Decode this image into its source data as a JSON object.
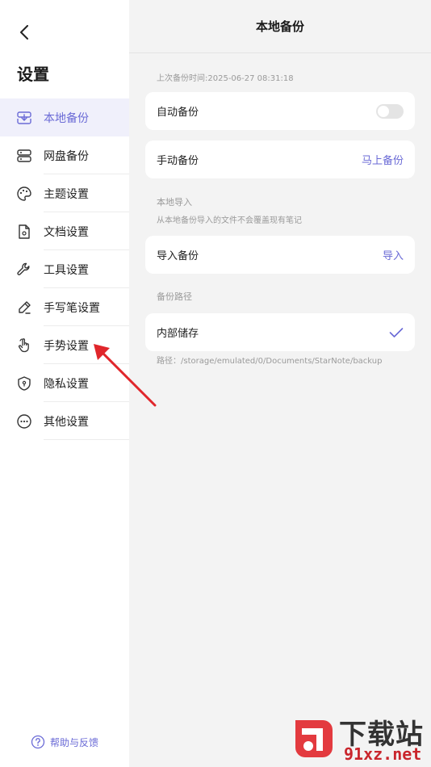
{
  "sidebar": {
    "title": "设置",
    "items": [
      {
        "label": "本地备份",
        "icon": "local-backup-icon"
      },
      {
        "label": "网盘备份",
        "icon": "cloud-disk-icon"
      },
      {
        "label": "主题设置",
        "icon": "palette-icon"
      },
      {
        "label": "文档设置",
        "icon": "document-icon"
      },
      {
        "label": "工具设置",
        "icon": "wrench-icon"
      },
      {
        "label": "手写笔设置",
        "icon": "pen-icon"
      },
      {
        "label": "手势设置",
        "icon": "gesture-hand-icon"
      },
      {
        "label": "隐私设置",
        "icon": "shield-icon"
      },
      {
        "label": "其他设置",
        "icon": "more-dots-icon"
      }
    ],
    "help_label": "帮助与反馈"
  },
  "main": {
    "title": "本地备份",
    "last_backup": "上次备份时间:2025-06-27 08:31:18",
    "auto_backup": {
      "label": "自动备份",
      "enabled": false
    },
    "manual_backup": {
      "label": "手动备份",
      "action": "马上备份"
    },
    "import_section": {
      "title": "本地导入",
      "note": "从本地备份导入的文件不会覆盖现有笔记",
      "label": "导入备份",
      "action": "导入"
    },
    "path_section": {
      "title": "备份路径",
      "option": "内部储存",
      "path": "路径：/storage/emulated/0/Documents/StarNote/backup"
    }
  },
  "watermark": {
    "line1": "下载站",
    "line2": "91xz.net"
  },
  "colors": {
    "accent": "#6a6ad6",
    "arrow": "#e0262b"
  }
}
